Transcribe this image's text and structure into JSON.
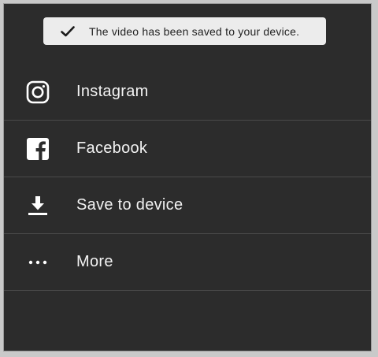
{
  "toast": {
    "icon": "checkmark-icon",
    "message": "The video has been saved to your device."
  },
  "share_options": [
    {
      "label": "Instagram",
      "icon": "instagram-icon"
    },
    {
      "label": "Facebook",
      "icon": "facebook-icon"
    },
    {
      "label": "Save to device",
      "icon": "download-icon"
    },
    {
      "label": "More",
      "icon": "more-dots-icon"
    }
  ],
  "colors": {
    "background": "#2c2c2c",
    "toast_background": "#ececec",
    "text": "#f2f2f2",
    "divider": "#4a4a4a"
  }
}
